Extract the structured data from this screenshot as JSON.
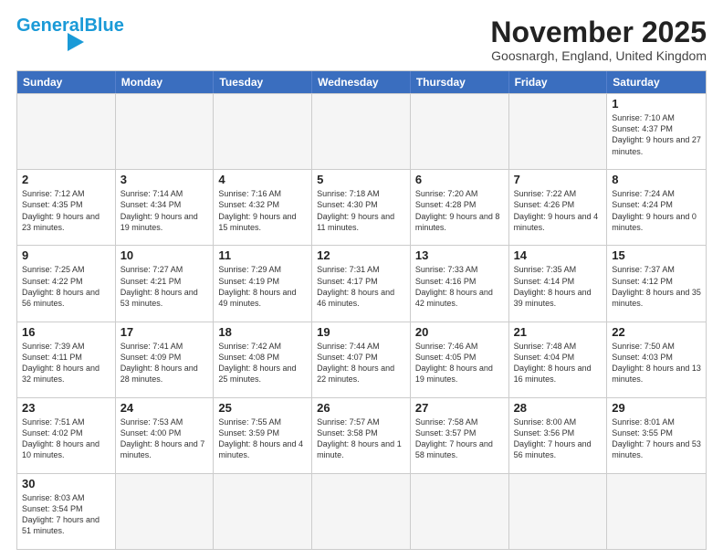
{
  "header": {
    "logo_general": "General",
    "logo_blue": "Blue",
    "month_title": "November 2025",
    "location": "Goosnargh, England, United Kingdom"
  },
  "days_of_week": [
    "Sunday",
    "Monday",
    "Tuesday",
    "Wednesday",
    "Thursday",
    "Friday",
    "Saturday"
  ],
  "weeks": [
    [
      {
        "day": "",
        "empty": true
      },
      {
        "day": "",
        "empty": true
      },
      {
        "day": "",
        "empty": true
      },
      {
        "day": "",
        "empty": true
      },
      {
        "day": "",
        "empty": true
      },
      {
        "day": "",
        "empty": true
      },
      {
        "day": "1",
        "sunrise": "7:10 AM",
        "sunset": "4:37 PM",
        "daylight": "9 hours and 27 minutes."
      }
    ],
    [
      {
        "day": "2",
        "sunrise": "7:12 AM",
        "sunset": "4:35 PM",
        "daylight": "9 hours and 23 minutes."
      },
      {
        "day": "3",
        "sunrise": "7:14 AM",
        "sunset": "4:34 PM",
        "daylight": "9 hours and 19 minutes."
      },
      {
        "day": "4",
        "sunrise": "7:16 AM",
        "sunset": "4:32 PM",
        "daylight": "9 hours and 15 minutes."
      },
      {
        "day": "5",
        "sunrise": "7:18 AM",
        "sunset": "4:30 PM",
        "daylight": "9 hours and 11 minutes."
      },
      {
        "day": "6",
        "sunrise": "7:20 AM",
        "sunset": "4:28 PM",
        "daylight": "9 hours and 8 minutes."
      },
      {
        "day": "7",
        "sunrise": "7:22 AM",
        "sunset": "4:26 PM",
        "daylight": "9 hours and 4 minutes."
      },
      {
        "day": "8",
        "sunrise": "7:24 AM",
        "sunset": "4:24 PM",
        "daylight": "9 hours and 0 minutes."
      }
    ],
    [
      {
        "day": "9",
        "sunrise": "7:25 AM",
        "sunset": "4:22 PM",
        "daylight": "8 hours and 56 minutes."
      },
      {
        "day": "10",
        "sunrise": "7:27 AM",
        "sunset": "4:21 PM",
        "daylight": "8 hours and 53 minutes."
      },
      {
        "day": "11",
        "sunrise": "7:29 AM",
        "sunset": "4:19 PM",
        "daylight": "8 hours and 49 minutes."
      },
      {
        "day": "12",
        "sunrise": "7:31 AM",
        "sunset": "4:17 PM",
        "daylight": "8 hours and 46 minutes."
      },
      {
        "day": "13",
        "sunrise": "7:33 AM",
        "sunset": "4:16 PM",
        "daylight": "8 hours and 42 minutes."
      },
      {
        "day": "14",
        "sunrise": "7:35 AM",
        "sunset": "4:14 PM",
        "daylight": "8 hours and 39 minutes."
      },
      {
        "day": "15",
        "sunrise": "7:37 AM",
        "sunset": "4:12 PM",
        "daylight": "8 hours and 35 minutes."
      }
    ],
    [
      {
        "day": "16",
        "sunrise": "7:39 AM",
        "sunset": "4:11 PM",
        "daylight": "8 hours and 32 minutes."
      },
      {
        "day": "17",
        "sunrise": "7:41 AM",
        "sunset": "4:09 PM",
        "daylight": "8 hours and 28 minutes."
      },
      {
        "day": "18",
        "sunrise": "7:42 AM",
        "sunset": "4:08 PM",
        "daylight": "8 hours and 25 minutes."
      },
      {
        "day": "19",
        "sunrise": "7:44 AM",
        "sunset": "4:07 PM",
        "daylight": "8 hours and 22 minutes."
      },
      {
        "day": "20",
        "sunrise": "7:46 AM",
        "sunset": "4:05 PM",
        "daylight": "8 hours and 19 minutes."
      },
      {
        "day": "21",
        "sunrise": "7:48 AM",
        "sunset": "4:04 PM",
        "daylight": "8 hours and 16 minutes."
      },
      {
        "day": "22",
        "sunrise": "7:50 AM",
        "sunset": "4:03 PM",
        "daylight": "8 hours and 13 minutes."
      }
    ],
    [
      {
        "day": "23",
        "sunrise": "7:51 AM",
        "sunset": "4:02 PM",
        "daylight": "8 hours and 10 minutes."
      },
      {
        "day": "24",
        "sunrise": "7:53 AM",
        "sunset": "4:00 PM",
        "daylight": "8 hours and 7 minutes."
      },
      {
        "day": "25",
        "sunrise": "7:55 AM",
        "sunset": "3:59 PM",
        "daylight": "8 hours and 4 minutes."
      },
      {
        "day": "26",
        "sunrise": "7:57 AM",
        "sunset": "3:58 PM",
        "daylight": "8 hours and 1 minute."
      },
      {
        "day": "27",
        "sunrise": "7:58 AM",
        "sunset": "3:57 PM",
        "daylight": "7 hours and 58 minutes."
      },
      {
        "day": "28",
        "sunrise": "8:00 AM",
        "sunset": "3:56 PM",
        "daylight": "7 hours and 56 minutes."
      },
      {
        "day": "29",
        "sunrise": "8:01 AM",
        "sunset": "3:55 PM",
        "daylight": "7 hours and 53 minutes."
      }
    ],
    [
      {
        "day": "30",
        "sunrise": "8:03 AM",
        "sunset": "3:54 PM",
        "daylight": "7 hours and 51 minutes."
      },
      {
        "day": "",
        "empty": true
      },
      {
        "day": "",
        "empty": true
      },
      {
        "day": "",
        "empty": true
      },
      {
        "day": "",
        "empty": true
      },
      {
        "day": "",
        "empty": true
      },
      {
        "day": "",
        "empty": true
      }
    ]
  ]
}
